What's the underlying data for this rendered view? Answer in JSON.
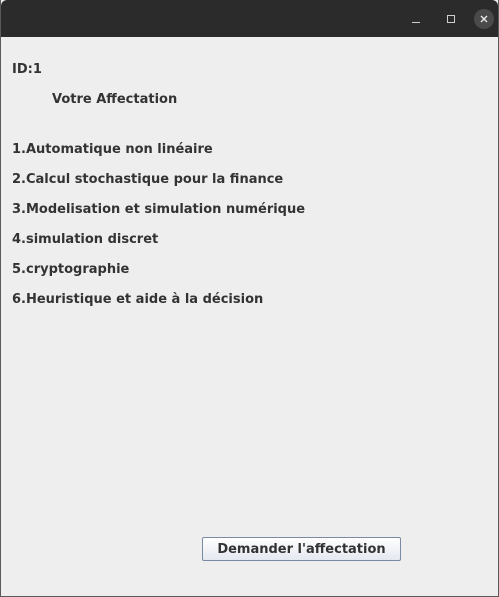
{
  "window": {
    "controls": {
      "minimize_icon": "minimize-icon",
      "maximize_icon": "maximize-icon",
      "close_icon": "close-icon"
    }
  },
  "main": {
    "id_label": "ID:1",
    "heading": "Votre Affectation",
    "items": [
      "1.Automatique non linéaire",
      "2.Calcul stochastique pour la finance",
      "3.Modelisation et simulation numérique",
      "4.simulation discret",
      "5.cryptographie",
      "6.Heuristique et aide à la décision"
    ],
    "request_button_label": "Demander l'affectation"
  }
}
